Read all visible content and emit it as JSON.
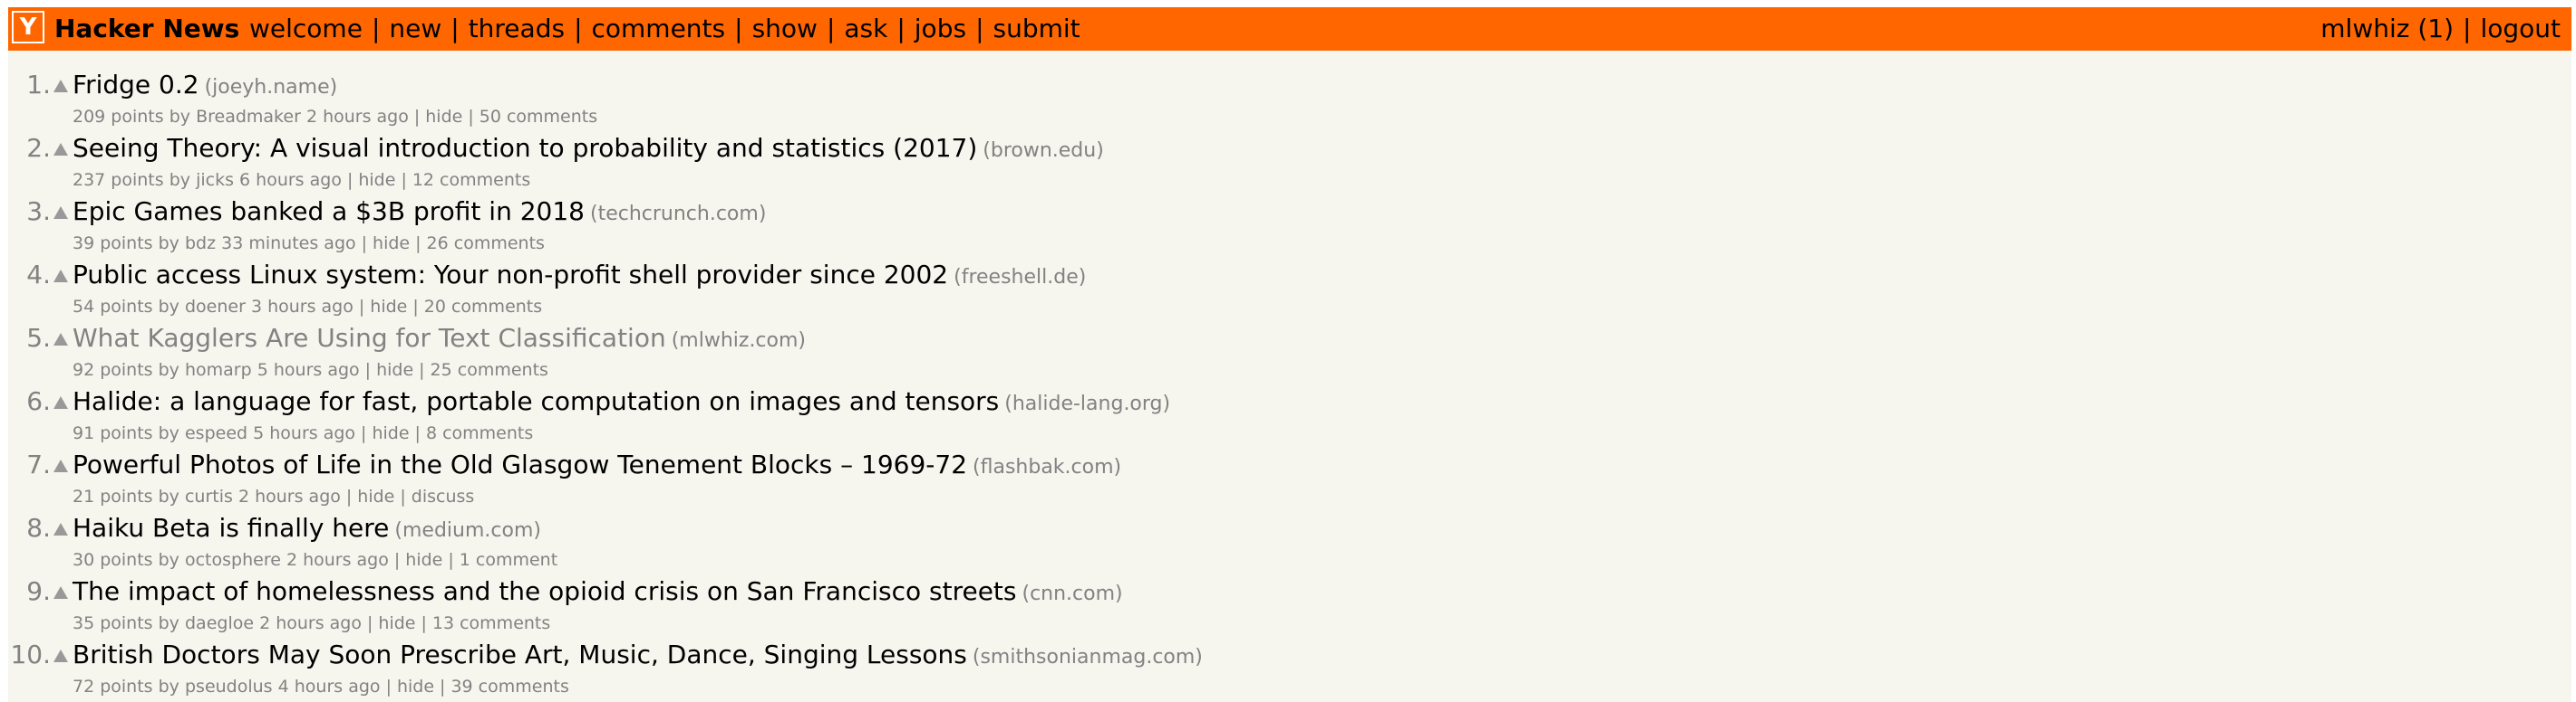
{
  "header": {
    "logo": "Y",
    "brand": "Hacker News",
    "nav": [
      "welcome",
      "new",
      "threads",
      "comments",
      "show",
      "ask",
      "jobs",
      "submit"
    ],
    "user": "mlwhiz (1)",
    "logout": "logout",
    "separator": "|",
    "colors": {
      "bar": "#ff6600",
      "page": "#f6f6ef",
      "muted": "#828282"
    }
  },
  "stories": [
    {
      "rank": "1.",
      "title": "Fridge 0.2",
      "site": "(joeyh.name)",
      "points": "209 points",
      "by": "by",
      "user": "Breadmaker",
      "age": "2 hours ago",
      "hide": "hide",
      "comments": "50 comments",
      "visited": false
    },
    {
      "rank": "2.",
      "title": "Seeing Theory: A visual introduction to probability and statistics (2017)",
      "site": "(brown.edu)",
      "points": "237 points",
      "by": "by",
      "user": "jicks",
      "age": "6 hours ago",
      "hide": "hide",
      "comments": "12 comments",
      "visited": false
    },
    {
      "rank": "3.",
      "title": "Epic Games banked a $3B profit in 2018",
      "site": "(techcrunch.com)",
      "points": "39 points",
      "by": "by",
      "user": "bdz",
      "age": "33 minutes ago",
      "hide": "hide",
      "comments": "26 comments",
      "visited": false
    },
    {
      "rank": "4.",
      "title": "Public access Linux system: Your non-profit shell provider since 2002",
      "site": "(freeshell.de)",
      "points": "54 points",
      "by": "by",
      "user": "doener",
      "age": "3 hours ago",
      "hide": "hide",
      "comments": "20 comments",
      "visited": false
    },
    {
      "rank": "5.",
      "title": "What Kagglers Are Using for Text Classification",
      "site": "(mlwhiz.com)",
      "points": "92 points",
      "by": "by",
      "user": "homarp",
      "age": "5 hours ago",
      "hide": "hide",
      "comments": "25 comments",
      "visited": true
    },
    {
      "rank": "6.",
      "title": "Halide: a language for fast, portable computation on images and tensors",
      "site": "(halide-lang.org)",
      "points": "91 points",
      "by": "by",
      "user": "espeed",
      "age": "5 hours ago",
      "hide": "hide",
      "comments": "8 comments",
      "visited": false
    },
    {
      "rank": "7.",
      "title": "Powerful Photos of Life in the Old Glasgow Tenement Blocks – 1969-72",
      "site": "(flashbak.com)",
      "points": "21 points",
      "by": "by",
      "user": "curtis",
      "age": "2 hours ago",
      "hide": "hide",
      "comments": "discuss",
      "visited": false
    },
    {
      "rank": "8.",
      "title": "Haiku Beta is finally here",
      "site": "(medium.com)",
      "points": "30 points",
      "by": "by",
      "user": "octosphere",
      "age": "2 hours ago",
      "hide": "hide",
      "comments": "1 comment",
      "visited": false
    },
    {
      "rank": "9.",
      "title": "The impact of homelessness and the opioid crisis on San Francisco streets",
      "site": "(cnn.com)",
      "points": "35 points",
      "by": "by",
      "user": "daegloe",
      "age": "2 hours ago",
      "hide": "hide",
      "comments": "13 comments",
      "visited": false
    },
    {
      "rank": "10.",
      "title": "British Doctors May Soon Prescribe Art, Music, Dance, Singing Lessons",
      "site": "(smithsonianmag.com)",
      "points": "72 points",
      "by": "by",
      "user": "pseudolus",
      "age": "4 hours ago",
      "hide": "hide",
      "comments": "39 comments",
      "visited": false
    }
  ]
}
